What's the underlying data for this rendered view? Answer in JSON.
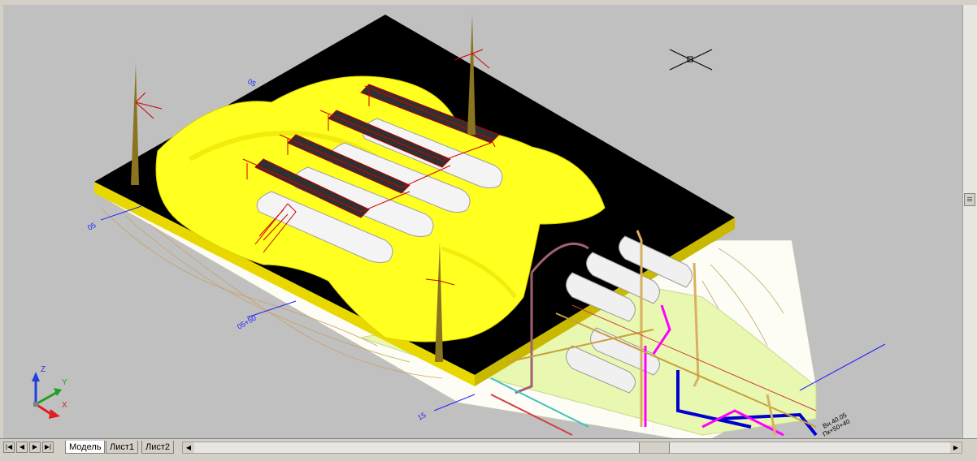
{
  "tabs": {
    "model": "Модель",
    "sheet1": "Лист1",
    "sheet2": "Лист2"
  },
  "nav": {
    "first": "|◀",
    "prev": "◀",
    "next": "▶",
    "last": "▶|"
  },
  "ucs": {
    "x_label": "X",
    "y_label": "Y",
    "z_label": "Z"
  },
  "drawing_labels": {
    "grid_top": "05",
    "grid_left": "05",
    "grid_mid": "05+50",
    "grid_bottom": "15",
    "elevation_1": "Вн.40.05",
    "elevation_2": "Пк+50+40"
  },
  "colors": {
    "background": "#c0c0c0",
    "yellow_terrain": "#ffff00",
    "platform": "#000000",
    "vessels": "#f0f0f0",
    "stairs": "#c00000",
    "pipes_blue": "#0000c0",
    "pipes_magenta": "#ff00ff"
  }
}
